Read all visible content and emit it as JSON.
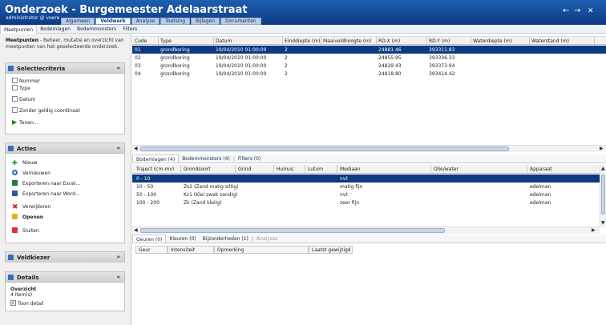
{
  "header": {
    "title": "Onderzoek - Burgemeester Adelaarstraat",
    "subtitle": "administrator @ veere",
    "tabs": [
      "Algemeen",
      "Veldwerk",
      "Analyse",
      "Toetsing",
      "Bijlagen",
      "Documenten"
    ],
    "active_tab": "Veldwerk",
    "nav_back": "←",
    "nav_forward": "→",
    "close": "✕"
  },
  "subtabs": [
    "Meetpunten",
    "Bodemlagen",
    "Bodemmonsters",
    "Filters"
  ],
  "sidebar": {
    "description_title": "Meetpunten",
    "description_text": " - Beheer, mutatie en overzicht van meetpunten van het geselecteerde onderzoek.",
    "selectiecriteria": {
      "title": "Selectiecriteria",
      "items": [
        "Nummer",
        "Type",
        "Datum",
        "Zonder geldig coordinaat"
      ],
      "show_label": "Tonen..."
    },
    "acties": {
      "title": "Acties",
      "items": [
        "Nieuw",
        "Vernieuwen",
        "Exporteren naar Excel...",
        "Exporteren naar Word...",
        "Verwijderen",
        "Openen",
        "Sluiten"
      ]
    },
    "veldkiezer": {
      "title": "Veldkiezer"
    },
    "details": {
      "title": "Details",
      "overview_label": "Overzicht",
      "count": "4 item(s)",
      "show_detail": "Toon detail"
    }
  },
  "meetpunten_table": {
    "columns": [
      "Code",
      "Type",
      "Datum",
      "Einddiepte (m)",
      "Maaiveldhoogte (m)",
      "RD-X (m)",
      "RD-Y (m)",
      "Waterdiepte (m)",
      "Waterstand (m)"
    ],
    "rows": [
      [
        "01",
        "grondboring",
        "19/04/2010 01:00:00",
        "2",
        "",
        "24881.46",
        "393311.83",
        "",
        ""
      ],
      [
        "02",
        "grondboring",
        "19/04/2010 01:00:00",
        "2",
        "",
        "24855.95",
        "393336.33",
        "",
        ""
      ],
      [
        "03",
        "grondboring",
        "19/04/2010 01:00:00",
        "2",
        "",
        "24829.43",
        "393373.94",
        "",
        ""
      ],
      [
        "04",
        "grondboring",
        "19/04/2010 01:00:00",
        "2",
        "",
        "24818.80",
        "393414.42",
        "",
        ""
      ]
    ],
    "selected_row": 0
  },
  "detail_tabs": [
    "Bodemlagen (4)",
    "Bodemmonsters (4)",
    "Filters (0)"
  ],
  "bodemlagen_table": {
    "columns": [
      "Traject (cm-mv)",
      "Grondsoort",
      "Grind",
      "Humus",
      "Lutum",
      "Mediaan",
      "Olie/water",
      "Apparaat"
    ],
    "rows": [
      [
        "0 - 10",
        "",
        "",
        "",
        "",
        "nvt",
        "",
        ""
      ],
      [
        "10 - 50",
        "Zs2 (Zand matig siltig)",
        "",
        "",
        "",
        "matig fijn",
        "",
        "edelman"
      ],
      [
        "50 - 100",
        "Kz1 (Klei zwak zandig)",
        "",
        "",
        "",
        "nvt",
        "",
        "edelman"
      ],
      [
        "100 - 200",
        "Zk (Zand kleiig)",
        "",
        "",
        "",
        "zeer fijn",
        "",
        "edelman"
      ]
    ],
    "selected_row": 0
  },
  "sub_tabs2": [
    "Geuren (0)",
    "Kleuren (0)",
    "Bijzonderheden (1)",
    "Analyses"
  ],
  "geuren_table": {
    "columns": [
      "Geur",
      "Intensiteit",
      "Opmerking",
      "Laatst gewijzigd"
    ]
  },
  "colors": {
    "header": "#0c3a82",
    "selection": "#0c3a82",
    "accent": "#1e5fb0"
  }
}
